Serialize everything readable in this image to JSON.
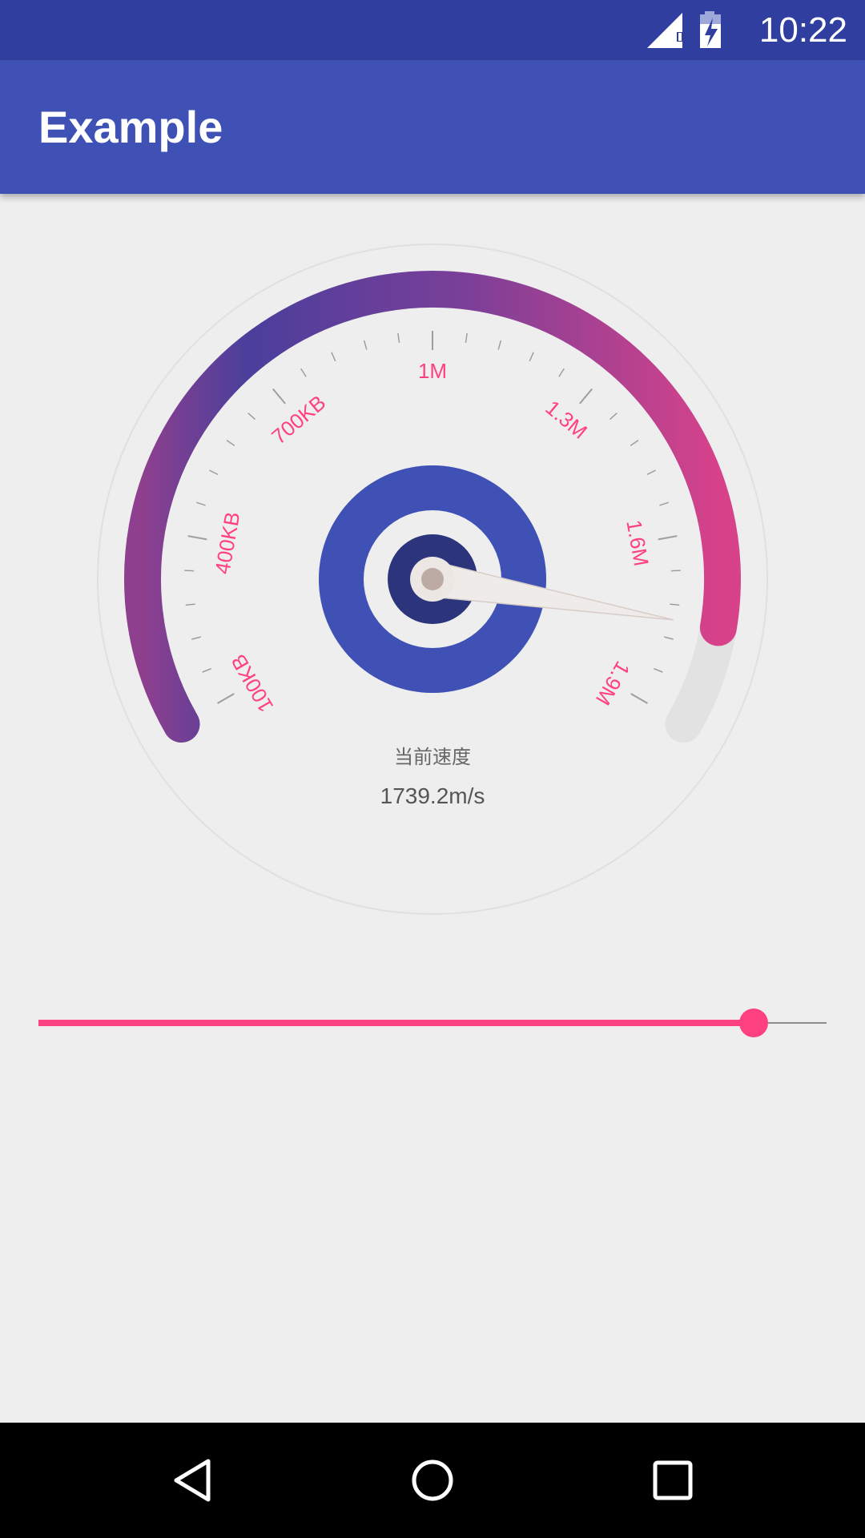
{
  "status_bar": {
    "time": "10:22",
    "icons": [
      "signal-icon",
      "battery-charging-icon"
    ]
  },
  "app_bar": {
    "title": "Example"
  },
  "gauge": {
    "scale_labels": [
      "100KB",
      "400KB",
      "700KB",
      "1M",
      "1.3M",
      "1.6M",
      "1.9M"
    ],
    "caption_label": "当前速度",
    "current_value": "1739.2m/s",
    "needle_fraction": 0.915,
    "colors": {
      "arc_start": "#8e3f8e",
      "arc_mid": "#4a3f9c",
      "arc_end": "#d8428a",
      "label": "#ff4081",
      "hub_outer": "#3f51b5",
      "hub_inner": "#2c357c"
    }
  },
  "slider": {
    "progress": 0.908,
    "color": "#ff4081"
  },
  "nav_bar": {
    "icons": [
      "back-icon",
      "home-icon",
      "recents-icon"
    ]
  }
}
